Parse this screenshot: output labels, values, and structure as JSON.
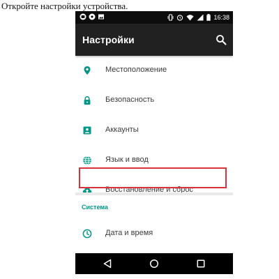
{
  "caption": "Откройте настройки устройства.",
  "status_bar": {
    "time": "16:38"
  },
  "app_bar": {
    "title": "Настройки",
    "search_icon": "search-icon"
  },
  "settings_items": [
    {
      "label": "Местоположение",
      "icon": "location-pin-icon"
    },
    {
      "label": "Безопасность",
      "icon": "lock-icon"
    },
    {
      "label": "Аккаунты",
      "icon": "account-box-icon"
    },
    {
      "label": "Язык и ввод",
      "icon": "globe-icon"
    },
    {
      "label": "Восстановление и сброс",
      "icon": "cloud-upload-icon",
      "highlighted": true
    }
  ],
  "system_section": {
    "header": "Система",
    "items": [
      {
        "label": "Дата и время",
        "icon": "clock-icon"
      }
    ]
  },
  "nav_bar": {
    "back": "back-triangle-icon",
    "home": "home-circle-icon",
    "recents": "recents-square-icon"
  },
  "colors": {
    "accent": "#009688",
    "app_bar": "#212121",
    "highlight_border": "#d9323c"
  }
}
